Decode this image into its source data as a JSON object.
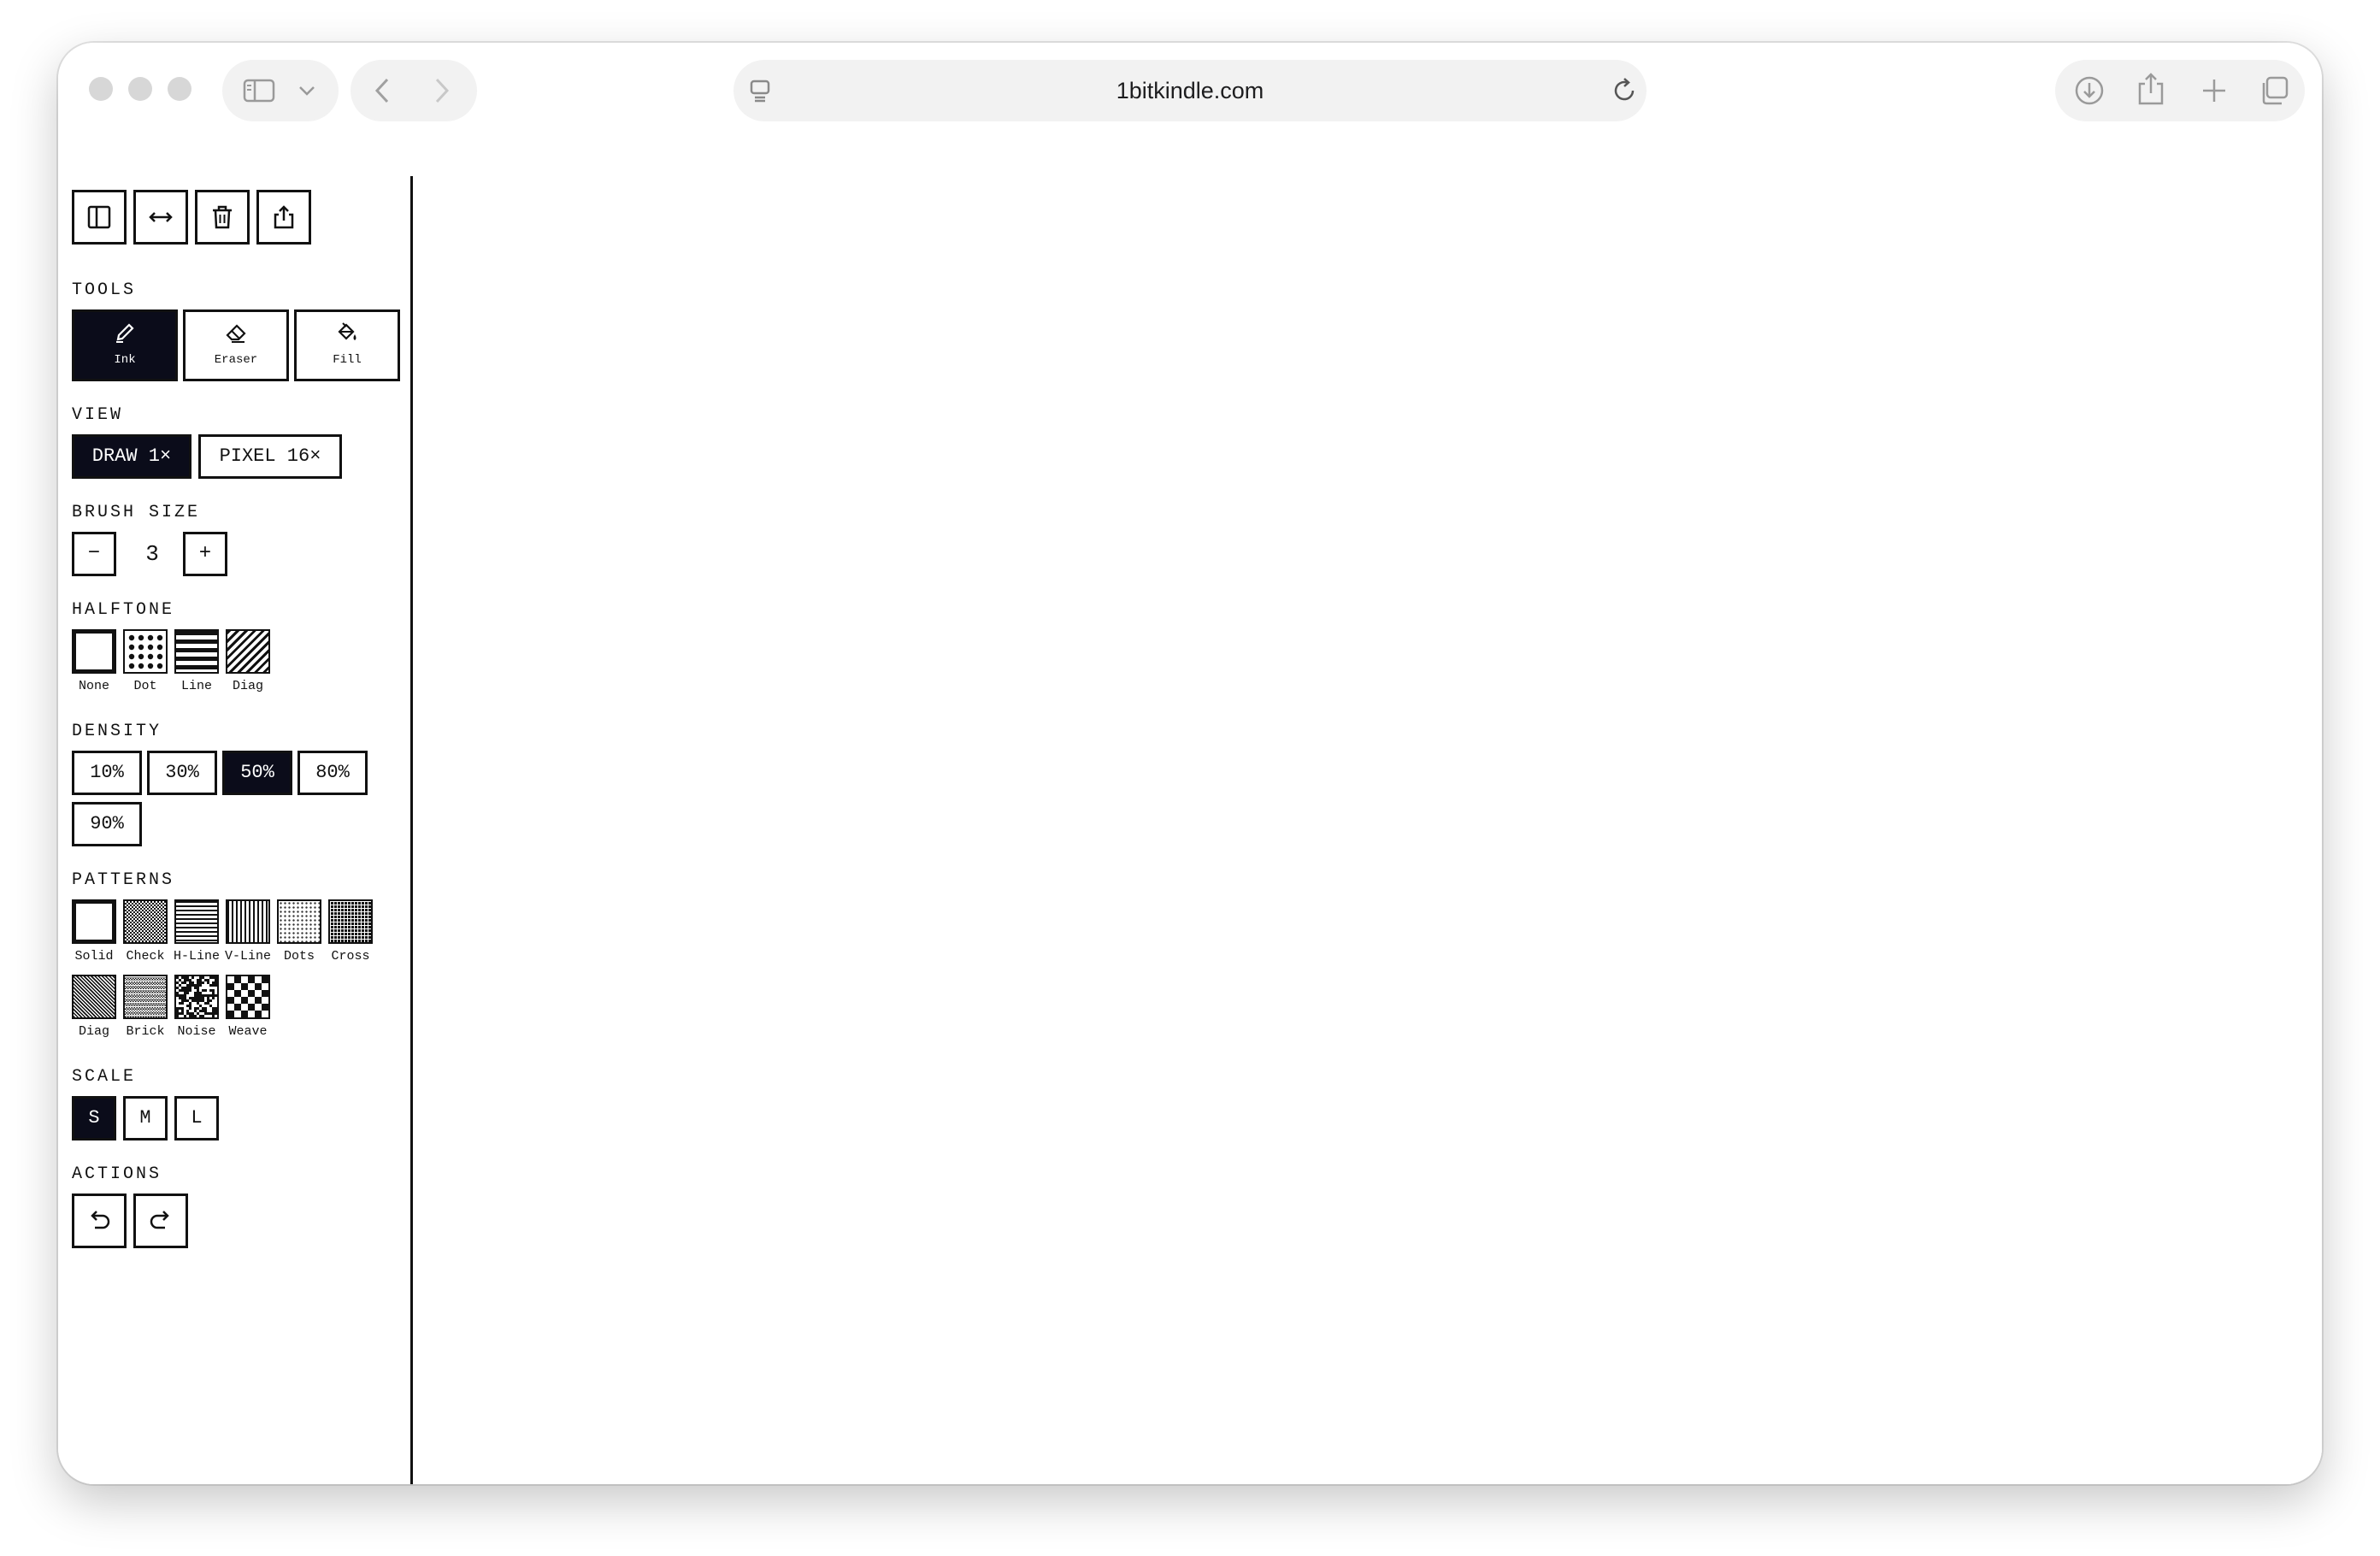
{
  "browser": {
    "url": "1bitkindle.com"
  },
  "sections": {
    "tools": "TOOLS",
    "view": "VIEW",
    "brush_size": "BRUSH SIZE",
    "halftone": "HALFTONE",
    "density": "DENSITY",
    "patterns": "PATTERNS",
    "scale": "SCALE",
    "actions": "ACTIONS"
  },
  "top_buttons": [
    "sidebar-toggle-icon",
    "width-toggle-icon",
    "trash-icon",
    "share-icon"
  ],
  "tools": [
    {
      "label": "Ink",
      "icon": "pencil-icon",
      "selected": true
    },
    {
      "label": "Eraser",
      "icon": "eraser-icon",
      "selected": false
    },
    {
      "label": "Fill",
      "icon": "paint-bucket-icon",
      "selected": false
    }
  ],
  "view": [
    {
      "label": "DRAW 1×",
      "selected": true
    },
    {
      "label": "PIXEL 16×",
      "selected": false
    }
  ],
  "brush": {
    "minus": "−",
    "value": "3",
    "plus": "+"
  },
  "halftone": [
    {
      "label": "None",
      "selected": true
    },
    {
      "label": "Dot",
      "selected": false
    },
    {
      "label": "Line",
      "selected": false
    },
    {
      "label": "Diag",
      "selected": false
    }
  ],
  "density": [
    {
      "label": "10%",
      "selected": false
    },
    {
      "label": "30%",
      "selected": false
    },
    {
      "label": "50%",
      "selected": true
    },
    {
      "label": "80%",
      "selected": false
    },
    {
      "label": "90%",
      "selected": false
    }
  ],
  "patterns": [
    {
      "label": "Solid",
      "selected": true
    },
    {
      "label": "Check",
      "selected": false
    },
    {
      "label": "H-Line",
      "selected": false
    },
    {
      "label": "V-Line",
      "selected": false
    },
    {
      "label": "Dots",
      "selected": false
    },
    {
      "label": "Cross",
      "selected": false
    },
    {
      "label": "Diag",
      "selected": false
    },
    {
      "label": "Brick",
      "selected": false
    },
    {
      "label": "Noise",
      "selected": false
    },
    {
      "label": "Weave",
      "selected": false
    }
  ],
  "scale": [
    {
      "label": "S",
      "selected": true
    },
    {
      "label": "M",
      "selected": false
    },
    {
      "label": "L",
      "selected": false
    }
  ],
  "actions": [
    "undo-icon",
    "redo-icon"
  ],
  "colors": {
    "ink": "#111111",
    "selected_bg": "#0b0c1a",
    "chrome": "#f2f2f2"
  }
}
